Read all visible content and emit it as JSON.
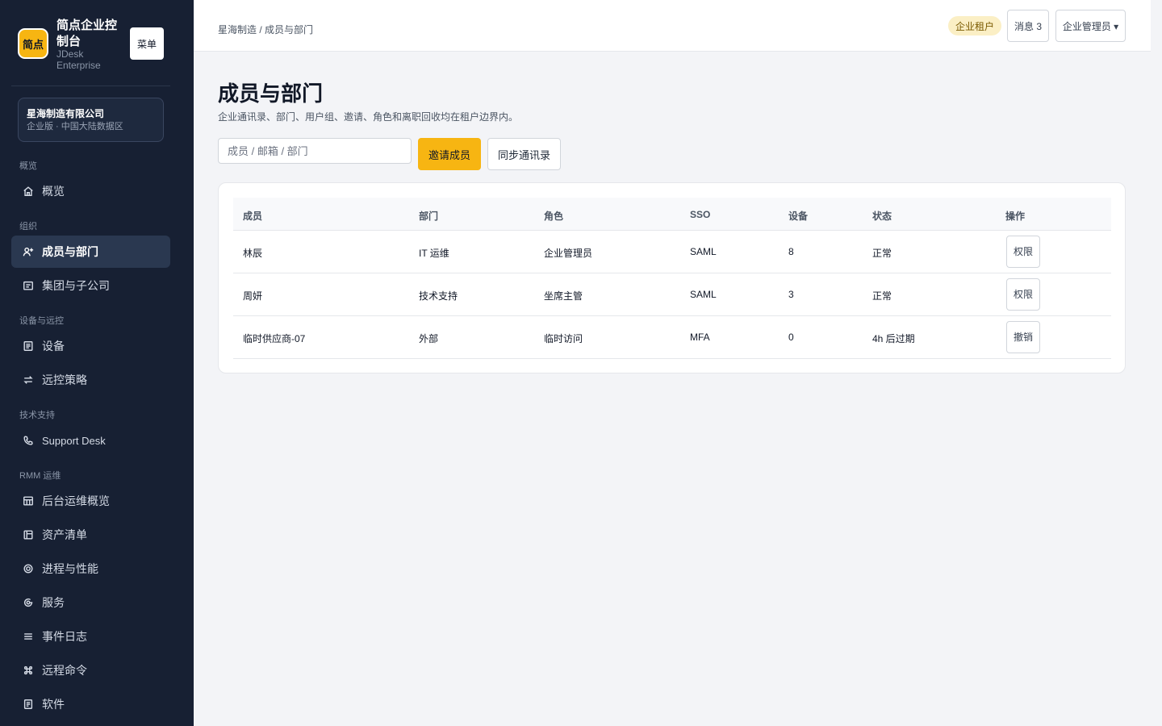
{
  "brand": {
    "logo_text": "简点",
    "name": "简点企业控制台",
    "subtitle": "JDesk Enterprise",
    "menu_label": "菜单"
  },
  "org": {
    "name": "星海制造有限公司",
    "plan": "企业版 · 中国大陆数据区"
  },
  "nav": {
    "groups": [
      "概览",
      "组织",
      "设备与远控",
      "技术支持",
      "RMM 运维"
    ],
    "items": [
      {
        "label": "概览",
        "icon": "home-icon"
      },
      {
        "label": "成员与部门",
        "icon": "user-plus-icon",
        "active": true
      },
      {
        "label": "集团与子公司",
        "icon": "building-icon"
      },
      {
        "label": "设备",
        "icon": "device-icon"
      },
      {
        "label": "远控策略",
        "icon": "swap-icon"
      },
      {
        "label": "Support Desk",
        "icon": "phone-icon"
      },
      {
        "label": "后台运维概览",
        "icon": "grid-icon"
      },
      {
        "label": "资产清单",
        "icon": "layout-icon"
      },
      {
        "label": "进程与性能",
        "icon": "target-icon"
      },
      {
        "label": "服务",
        "icon": "service-icon"
      },
      {
        "label": "事件日志",
        "icon": "list-icon"
      },
      {
        "label": "远程命令",
        "icon": "command-icon"
      },
      {
        "label": "软件",
        "icon": "file-icon"
      }
    ]
  },
  "topbar": {
    "breadcrumb": "星海制造 / 成员与部门",
    "tenant_badge": "企业租户",
    "messages": "消息 3",
    "admin_menu": "企业管理员 ▾"
  },
  "page": {
    "title": "成员与部门",
    "description": "企业通讯录、部门、用户组、邀请、角色和离职回收均在租户边界内。",
    "search_placeholder": "成员 / 邮箱 / 部门",
    "invite_label": "邀请成员",
    "sync_label": "同步通讯录"
  },
  "table": {
    "columns": [
      "成员",
      "部门",
      "角色",
      "SSO",
      "设备",
      "状态",
      "操作"
    ],
    "rows": [
      {
        "member": "林辰",
        "dept": "IT 运维",
        "role": "企业管理员",
        "sso": "SAML",
        "devices": "8",
        "status": "正常",
        "action": "权限"
      },
      {
        "member": "周妍",
        "dept": "技术支持",
        "role": "坐席主管",
        "sso": "SAML",
        "devices": "3",
        "status": "正常",
        "action": "权限"
      },
      {
        "member": "临时供应商-07",
        "dept": "外部",
        "role": "临时访问",
        "sso": "MFA",
        "devices": "0",
        "status": "4h 后过期",
        "action": "撤销"
      }
    ]
  },
  "colors": {
    "sidebar_bg": "#172033",
    "accent": "#f7b512",
    "page_bg": "#f3f4f7"
  }
}
